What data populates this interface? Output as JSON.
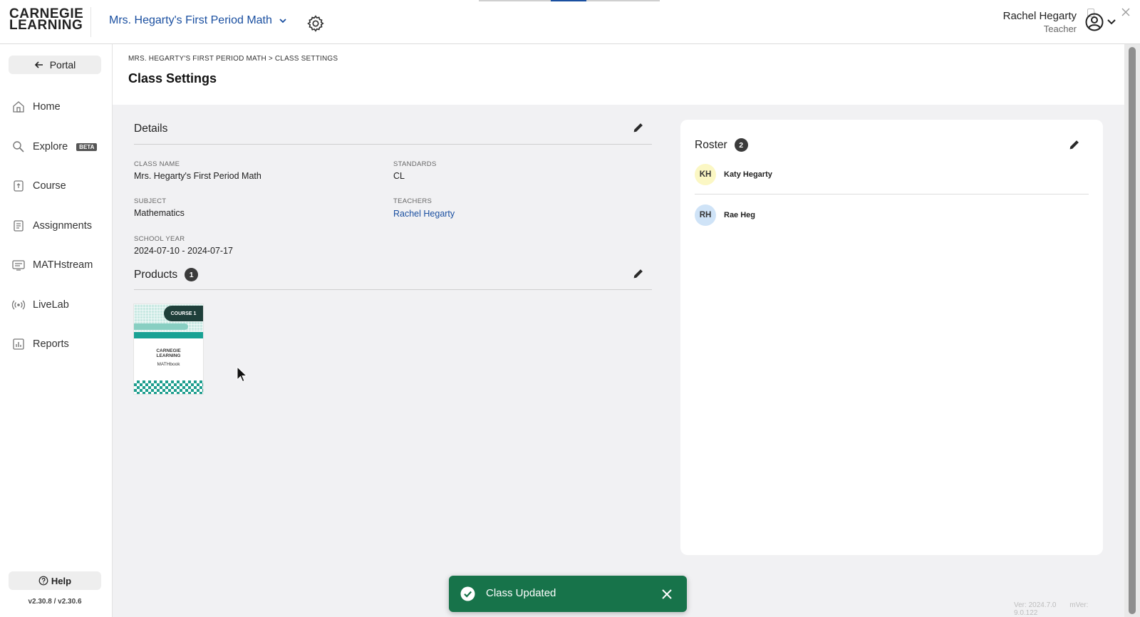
{
  "header": {
    "logo_line1": "CARNEGIE",
    "logo_line2": "LEARNING",
    "class_name": "Mrs. Hegarty's First Period Math",
    "user_name": "Rachel Hegarty",
    "user_role": "Teacher"
  },
  "sidebar": {
    "portal_label": "Portal",
    "items": [
      {
        "label": "Home",
        "icon": "home-icon"
      },
      {
        "label": "Explore",
        "icon": "search-icon",
        "badge": "BETA"
      },
      {
        "label": "Course",
        "icon": "course-icon"
      },
      {
        "label": "Assignments",
        "icon": "assignments-icon"
      },
      {
        "label": "MATHstream",
        "icon": "mathstream-icon"
      },
      {
        "label": "LiveLab",
        "icon": "livelab-icon"
      },
      {
        "label": "Reports",
        "icon": "reports-icon"
      }
    ],
    "help_label": "Help",
    "version": "v2.30.8 / v2.30.6"
  },
  "page": {
    "breadcrumb": "MRS. HEGARTY'S FIRST PERIOD MATH > CLASS SETTINGS",
    "title": "Class Settings"
  },
  "details": {
    "title": "Details",
    "class_name_label": "CLASS NAME",
    "class_name_value": "Mrs. Hegarty's First Period Math",
    "standards_label": "STANDARDS",
    "standards_value": "CL",
    "subject_label": "SUBJECT",
    "subject_value": "Mathematics",
    "teachers_label": "TEACHERS",
    "teachers_value": "Rachel Hegarty",
    "school_year_label": "SCHOOL YEAR",
    "school_year_value": "2024-07-10 - 2024-07-17"
  },
  "products": {
    "title": "Products",
    "count": "1",
    "cover": {
      "course_label": "COURSE 1",
      "brand_line1": "CARNEGIE",
      "brand_line2": "LEARNING",
      "book_title": "MATHbook"
    }
  },
  "roster": {
    "title": "Roster",
    "count": "2",
    "students": [
      {
        "initials": "KH",
        "name": "Katy Hegarty",
        "color": "#fbf7c4"
      },
      {
        "initials": "RH",
        "name": "Rae Heg",
        "color": "#cfe3f7"
      }
    ]
  },
  "footer": {
    "ver": "Ver: 2024.7.0",
    "mver": "mVer: 9.0.122"
  },
  "toast": {
    "message": "Class Updated",
    "color": "#17734a"
  }
}
